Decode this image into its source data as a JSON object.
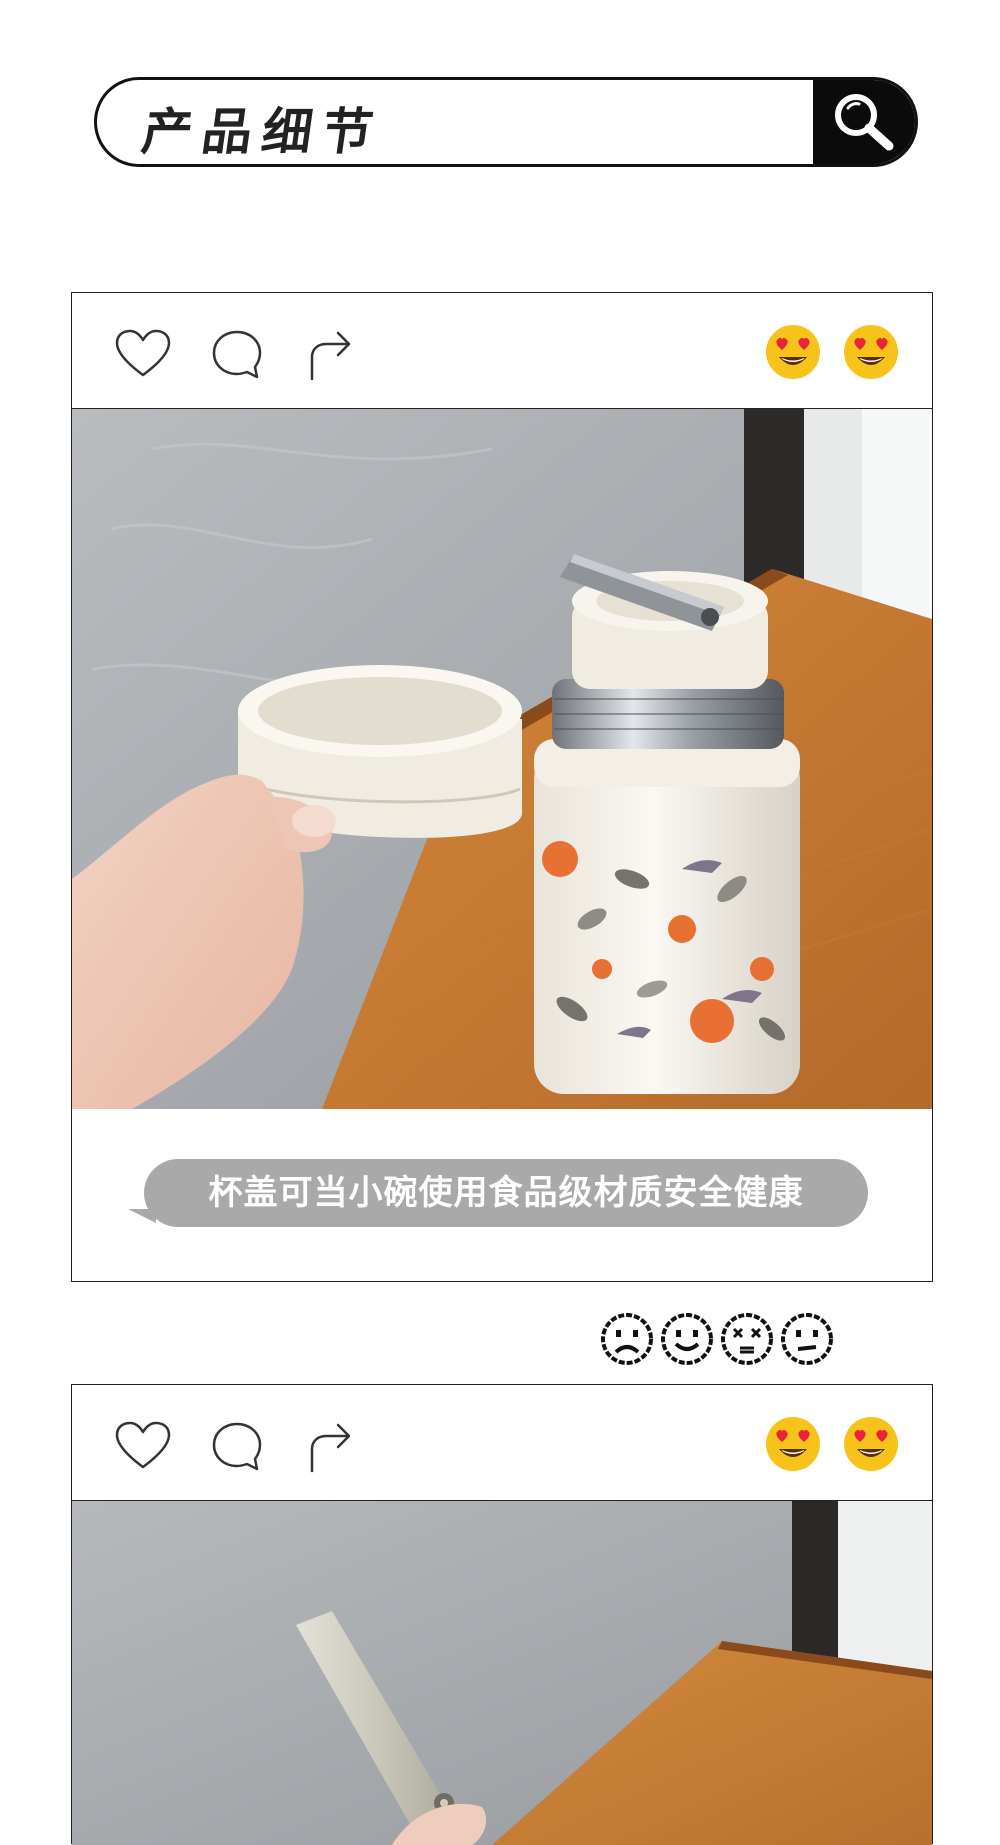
{
  "header": {
    "title": "产品细节",
    "search_icon": "search-icon"
  },
  "cards": [
    {
      "actions": [
        "heart-icon",
        "comment-icon",
        "share-icon"
      ],
      "emojis": [
        "heart-eyes-emoji",
        "heart-eyes-emoji"
      ],
      "photo": "bowl-lid-and-food-jar-photo",
      "caption": "杯盖可当小碗使用食品级材质安全健康"
    },
    {
      "actions": [
        "heart-icon",
        "comment-icon",
        "share-icon"
      ],
      "emojis": [
        "heart-eyes-emoji",
        "heart-eyes-emoji"
      ],
      "photo": "folding-spoon-photo"
    }
  ],
  "faces": [
    "sad-face-icon",
    "smile-face-icon",
    "dizzy-face-icon",
    "neutral-face-icon"
  ],
  "colors": {
    "border": "#222222",
    "search_button": "#0b0b0b",
    "caption_bubble": "#a9a9a9",
    "emoji_yellow": "#f7c21a",
    "emoji_heart": "#e8243c"
  }
}
